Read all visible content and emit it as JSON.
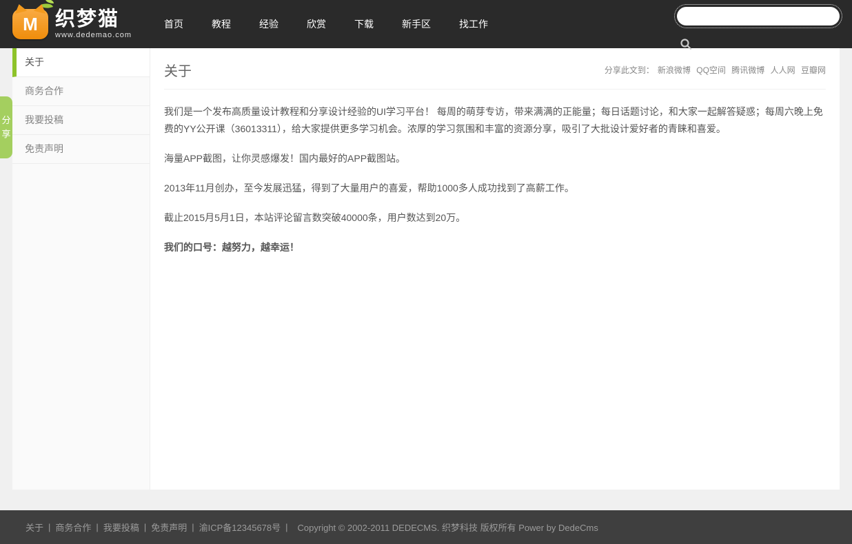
{
  "brand": {
    "title": "织梦猫",
    "url": "www.dedemao.com",
    "logo_letter": "M",
    "orange": "#f39a1e",
    "green": "#a4cf5f"
  },
  "header": {
    "nav": [
      {
        "label": "首页"
      },
      {
        "label": "教程"
      },
      {
        "label": "经验"
      },
      {
        "label": "欣赏"
      },
      {
        "label": "下载"
      },
      {
        "label": "新手区"
      },
      {
        "label": "找工作"
      }
    ],
    "search": {
      "value": "",
      "placeholder": ""
    }
  },
  "share_tab": {
    "label": "分享"
  },
  "sidebar": {
    "items": [
      {
        "label": "关于",
        "active": true
      },
      {
        "label": "商务合作",
        "active": false
      },
      {
        "label": "我要投稿",
        "active": false
      },
      {
        "label": "免责声明",
        "active": false
      }
    ]
  },
  "main": {
    "title": "关于",
    "share_bar": {
      "prefix": "分享此文到：",
      "links": [
        "新浪微博",
        "QQ空间",
        "腾讯微博",
        "人人网",
        "豆瓣网"
      ]
    },
    "paragraphs": [
      "我们是一个发布高质量设计教程和分享设计经验的UI学习平台！ 每周的萌芽专访，带来满满的正能量；每日话题讨论，和大家一起解答疑惑；每周六晚上免费的YY公开课（36013311），给大家提供更多学习机会。浓厚的学习氛围和丰富的资源分享，吸引了大批设计爱好者的青睐和喜爱。",
      "海量APP截图，让你灵感爆发！国内最好的APP截图站。",
      "2013年11月创办，至今发展迅猛，得到了大量用户的喜爱，帮助1000多人成功找到了高薪工作。",
      "截止2015月5月1日，本站评论留言数突破40000条，用户数达到20万。"
    ],
    "slogan": "我们的口号：越努力，越幸运！",
    "slogan_color": "#ef7c2a"
  },
  "footer": {
    "links": [
      "关于",
      "商务合作",
      "我要投稿",
      "免责声明"
    ],
    "separator": "|",
    "icp": "渝ICP备12345678号",
    "copyright": "Copyright © 2002-2011 DEDECMS. 织梦科技 版权所有 Power by DedeCms"
  },
  "colors": {
    "header_bg": "#2a2a2a",
    "footer_bg": "#3f3f3f",
    "page_bg": "#f0f0f0",
    "accent_green": "#8ec32a",
    "tab_green": "#a4cf5f"
  }
}
